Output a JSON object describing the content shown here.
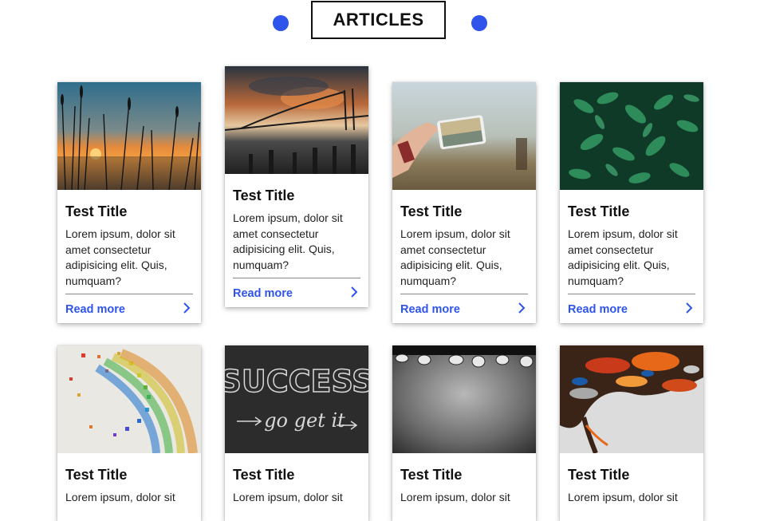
{
  "header": {
    "title": "ARTICLES",
    "accent": "#2f54eb"
  },
  "cards": [
    {
      "title": "Test Title",
      "text": "Lorem ipsum, dolor sit amet consectetur adipisicing elit. Quis, numquam?",
      "link": "Read more",
      "image": "sunset-reeds-photo"
    },
    {
      "title": "Test Title",
      "text": "Lorem ipsum, dolor sit amet consectetur adipisicing elit. Quis, numquam?",
      "link": "Read more",
      "image": "bridge-sunset-photo"
    },
    {
      "title": "Test Title",
      "text": "Lorem ipsum, dolor sit amet consectetur adipisicing elit. Quis, numquam?",
      "link": "Read more",
      "image": "phone-photo"
    },
    {
      "title": "Test Title",
      "text": "Lorem ipsum, dolor sit amet consectetur adipisicing elit. Quis, numquam?",
      "link": "Read more",
      "image": "green-leaves-photo"
    },
    {
      "title": "Test Title",
      "text": "Lorem ipsum, dolor sit",
      "image": "rainbow-confetti-photo"
    },
    {
      "title": "Test Title",
      "text": "Lorem ipsum, dolor sit",
      "image": "success-chalkboard-photo"
    },
    {
      "title": "Test Title",
      "text": "Lorem ipsum, dolor sit",
      "image": "gray-gradient-photo"
    },
    {
      "title": "Test Title",
      "text": "Lorem ipsum, dolor sit",
      "image": "abstract-paint-photo"
    }
  ],
  "chalkboard_text": {
    "line1": "SUCCESS",
    "line2": "go get it"
  }
}
